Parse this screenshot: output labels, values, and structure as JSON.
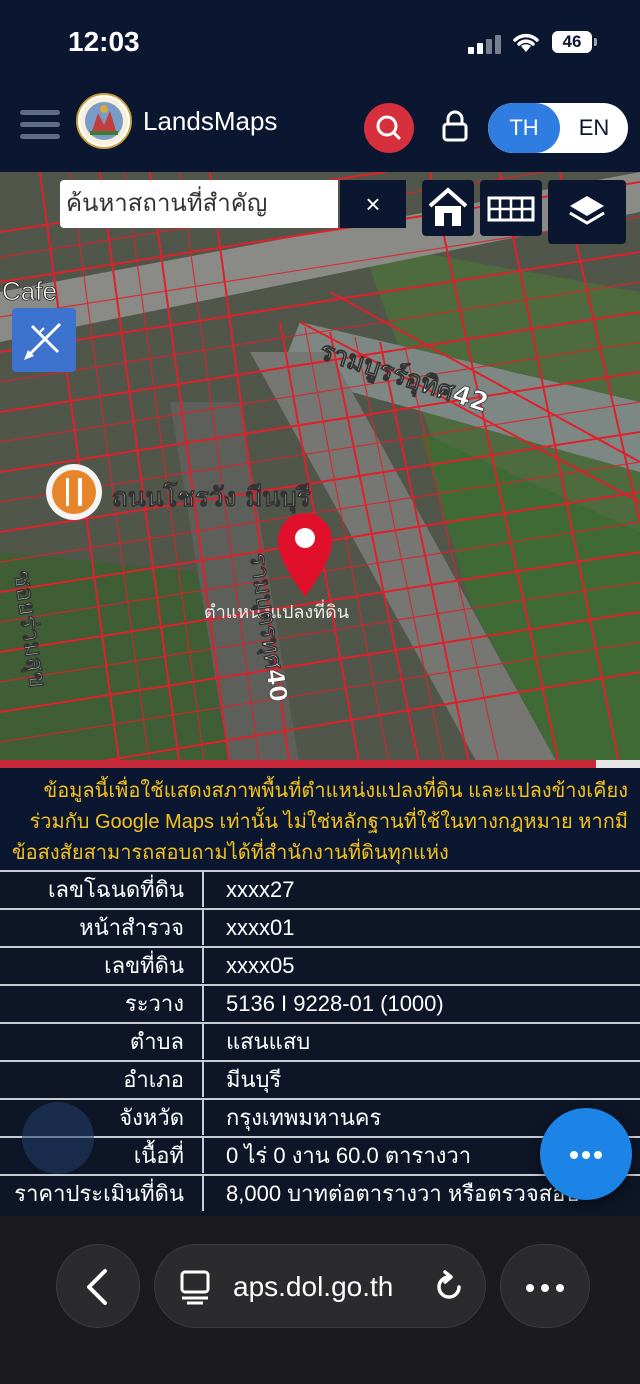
{
  "status_bar": {
    "time": "12:03",
    "battery": "46"
  },
  "header": {
    "app_title": "LandsMaps",
    "lang_th": "TH",
    "lang_en": "EN"
  },
  "map": {
    "search_placeholder": "ค้นหาสถานที่สำคัญ",
    "clear_symbol": "×",
    "labels": {
      "cafe": "Cafe",
      "road_top": "รามบูรร์อุทิศ42",
      "poi": "ถนนโชรวัง มีนบุรี",
      "pin_caption": "ตำแหน่งแปลงที่ดิน",
      "road_mid": "รามบุตรทุศ40",
      "soi_left": "ซอยร่วมสุข"
    }
  },
  "disclaimer": {
    "line1": "ข้อมูลนี้เพื่อใช้แสดงสภาพพื้นที่ตำแหน่งแปลงที่ดิน และแปลงข้างเคียง",
    "line2": "ร่วมกับ Google Maps เท่านั้น ไม่ใช่หลักฐานที่ใช้ในทางกฎหมาย หากมี",
    "line3": "ข้อสงสัยสามารถสอบถามได้ที่สำนักงานที่ดินทุกแห่ง"
  },
  "parcel": {
    "deed_no": {
      "label": "เลขโฉนดที่ดิน",
      "value": "xxxx27"
    },
    "survey_page": {
      "label": "หน้าสำรวจ",
      "value": "xxxx01"
    },
    "land_no": {
      "label": "เลขที่ดิน",
      "value": "xxxx05"
    },
    "map_sheet": {
      "label": "ระวาง",
      "value": "5136 I 9228-01 (1000)"
    },
    "subdistrict": {
      "label": "ตำบล",
      "value": "แสนแสบ"
    },
    "district": {
      "label": "อำเภอ",
      "value": "มีนบุรี"
    },
    "province": {
      "label": "จังหวัด",
      "value": "กรุงเทพมหานคร"
    },
    "area": {
      "label": "เนื้อที่",
      "value": "0 ไร่ 0 งาน 60.0 ตารางวา"
    },
    "appraisal": {
      "label": "ราคาประเมินที่ดิน",
      "value": "8,000 บาทต่อตารางวา หรือตรวจสอบ"
    }
  },
  "browser": {
    "url": "aps.dol.go.th"
  },
  "colors": {
    "navy": "#0b1730",
    "accent_blue": "#2f7de1",
    "search_red": "#d6303c",
    "disclaimer_yellow": "#f3c21c",
    "parcel_red": "#e0202a"
  }
}
